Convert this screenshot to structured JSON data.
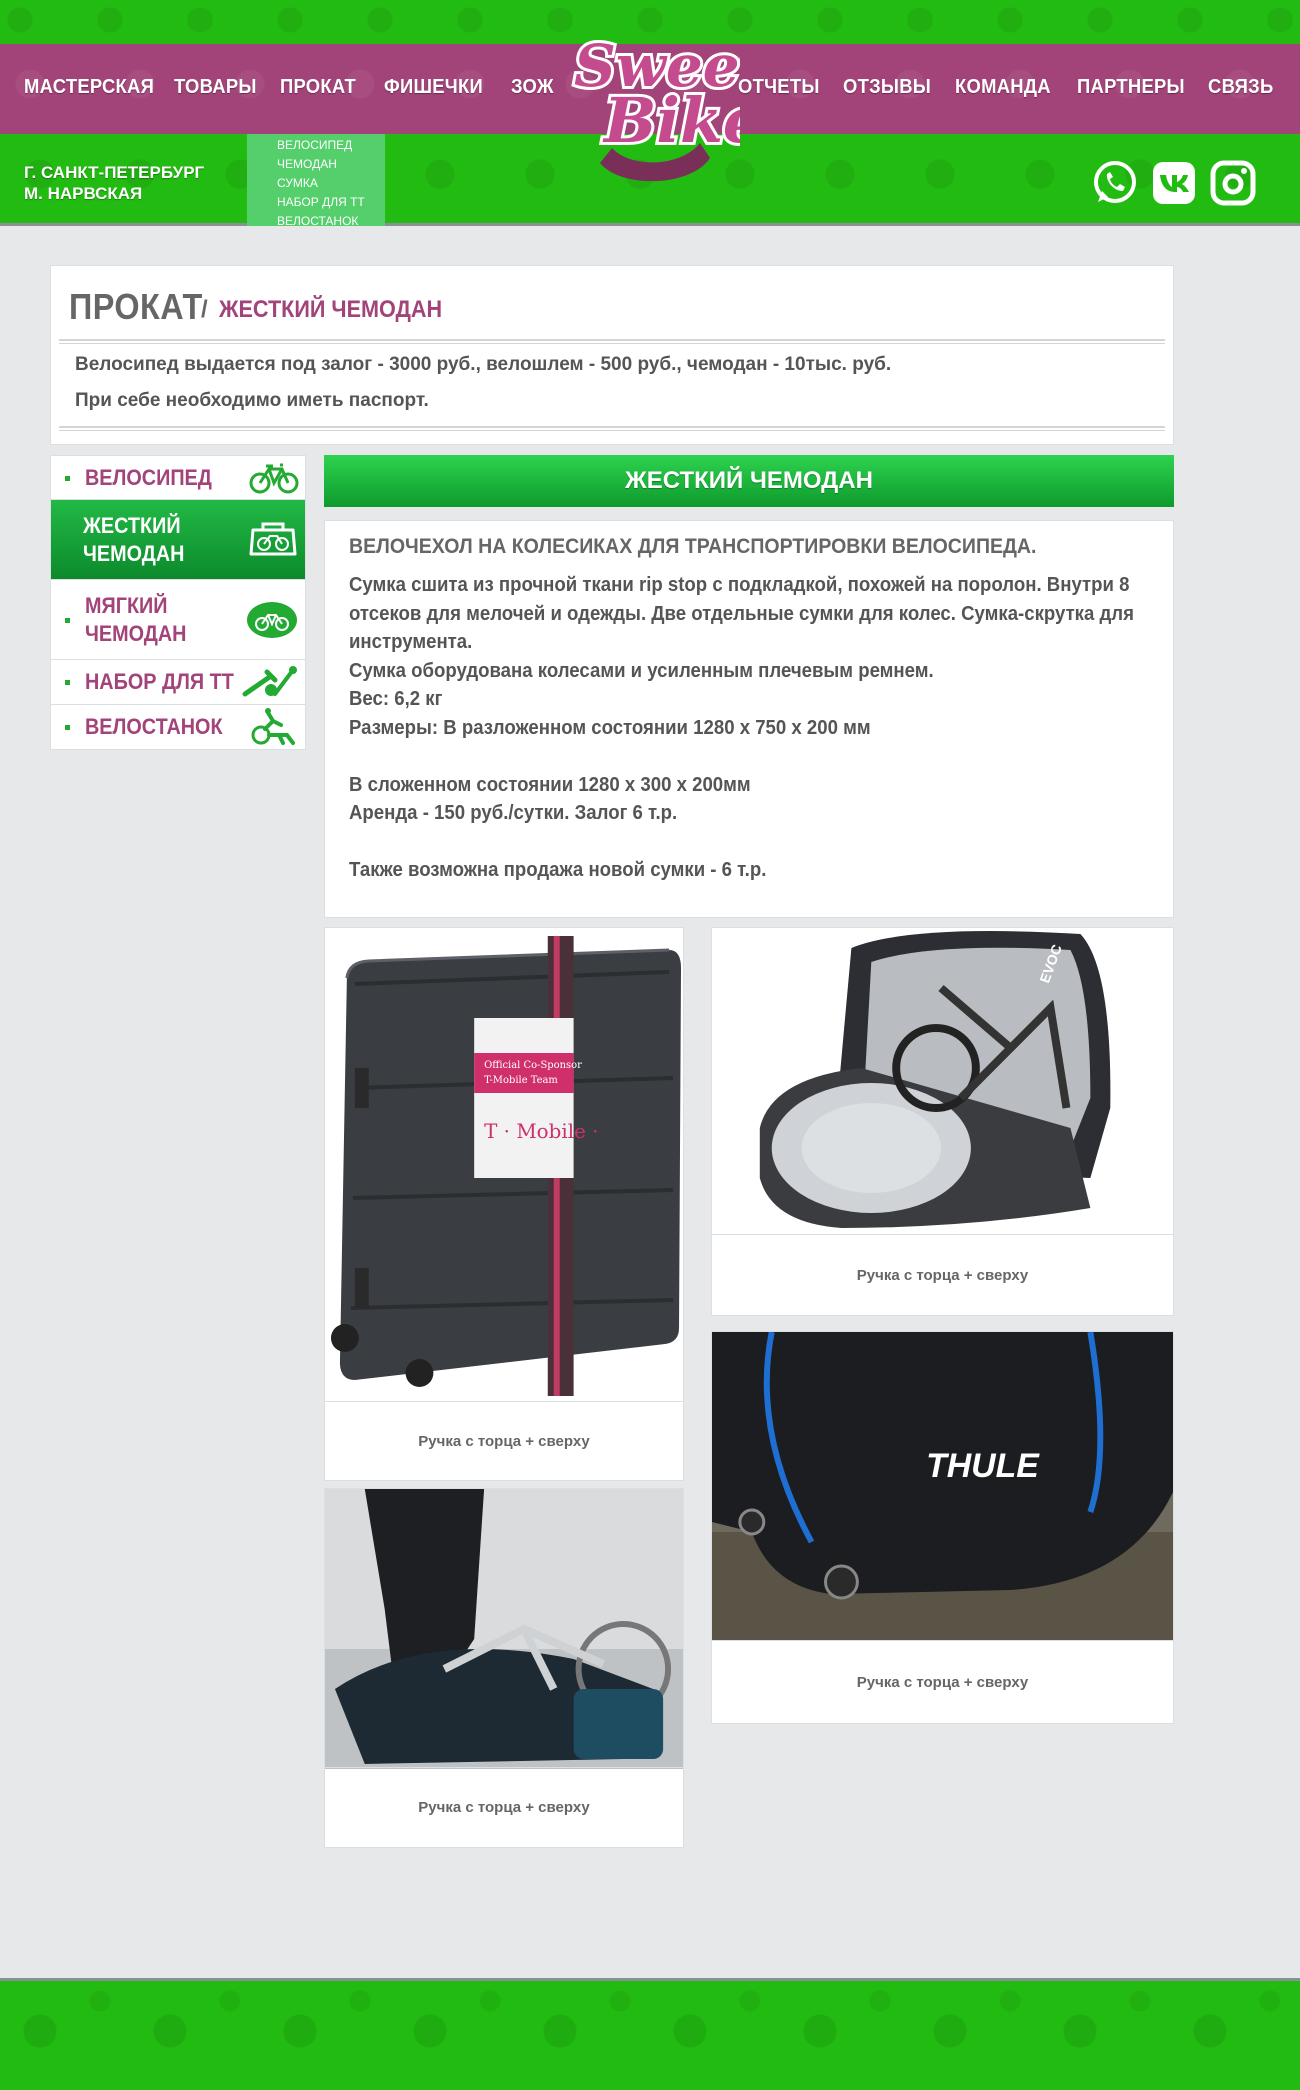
{
  "brand": {
    "logo_line1": "Sweet",
    "logo_line2": "Bike"
  },
  "nav": {
    "left": [
      "МАСТЕРСКАЯ",
      "ТОВАРЫ",
      "ПРОКАТ",
      "ФИШЕЧКИ",
      "ЗОЖ"
    ],
    "right": [
      "ОТЧЕТЫ",
      "ОТЗЫВЫ",
      "КОМАНДА",
      "ПАРТНЕРЫ",
      "СВЯЗЬ"
    ]
  },
  "location": {
    "city": "Г. САНКТ-ПЕТЕРБУРГ",
    "metro": "М. НАРВСКАЯ"
  },
  "submenu": [
    "ВЕЛОСИПЕД",
    "ЧЕМОДАН",
    "СУМКА",
    "НАБОР ДЛЯ ТТ",
    "ВЕЛОСТАНОК"
  ],
  "social": [
    "whatsapp-icon",
    "vk-icon",
    "instagram-icon"
  ],
  "breadcrumb": {
    "section": "ПРОКАТ",
    "separator": "/",
    "page": "ЖЕСТКИЙ ЧЕМОДАН"
  },
  "notice": {
    "line1": "Велосипед выдается под залог - 3000 руб., велошлем - 500 руб., чемодан - 10тыс. руб.",
    "line2": "При себе необходимо иметь паспорт."
  },
  "sidebar": [
    {
      "label": "ВЕЛОСИПЕД",
      "active": false
    },
    {
      "label": "ЖЕСТКИЙ\nЧЕМОДАН",
      "active": true
    },
    {
      "label": "МЯГКИЙ\nЧЕМОДАН",
      "active": false
    },
    {
      "label": "НАБОР ДЛЯ ТТ",
      "active": false
    },
    {
      "label": "ВЕЛОСТАНОК",
      "active": false
    }
  ],
  "product": {
    "header": "ЖЕСТКИЙ ЧЕМОДАН",
    "title": "ВЕЛОЧЕХОЛ НА КОЛЕСИКАХ ДЛЯ ТРАНСПОРТИРОВКИ ВЕЛОСИПЕДА.",
    "body": "Сумка сшита из прочной ткани rip stop с подкладкой, похожей на поролон. Внутри 8\nотсеков для мелочей и одежды. Две отдельные сумки для колес. Сумка-скрутка для\nинструмента.\nСумка оборудована колесами и усиленным плечевым ремнем.\nВес: 6,2 кг\nРазмеры: В разложенном состоянии 1280 х 750 х 200 мм\n\nВ сложенном состоянии 1280 х 300 х 200мм\nАренда - 150 руб./сутки. Залог 6 т.р.\n\nТакже возможна продажа новой сумки - 6 т.р."
  },
  "gallery": [
    {
      "caption": "Ручка с торца + сверху",
      "image": "hard-bike-case-photo",
      "label_line1": "Official Co-Sponsor",
      "label_line2": "T-Mobile Team",
      "label_brand": "T · Mobile ·"
    },
    {
      "caption": "Ручка с торца + сверху",
      "image": "open-bike-bag-photo",
      "label_brand": "EVOC"
    },
    {
      "caption": "Ручка с торца + сверху",
      "image": "thule-bag-photo",
      "label_brand": "THULE"
    },
    {
      "caption": "Ручка с торца + сверху",
      "image": "packing-bike-photo"
    }
  ],
  "colors": {
    "green": "#22bb11",
    "magenta": "#a24379",
    "accent_green": "#0e9a34",
    "page_bg": "#e6e8e9"
  }
}
